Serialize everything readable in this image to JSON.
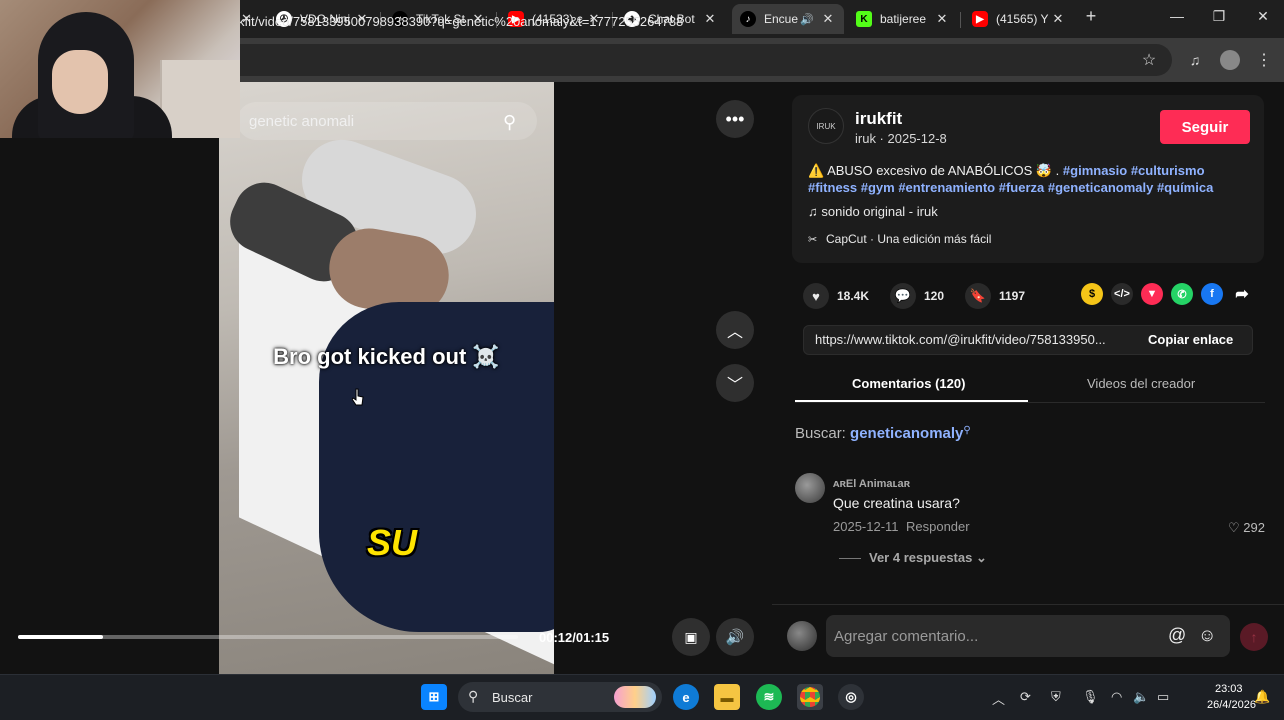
{
  "browser": {
    "tabs": [
      {
        "title": "VDO.Ninj",
        "icon": "vdo-ninja-icon",
        "icon_glyph": "✇",
        "color": "#ffffff"
      },
      {
        "title": "TikTok St",
        "icon": "tiktok-icon",
        "icon_glyph": "♪",
        "color": "#000000"
      },
      {
        "title": "(41533) c",
        "icon": "youtube-icon",
        "icon_glyph": "▶",
        "color": "#ff0000"
      },
      {
        "title": "Chat Bot",
        "icon": "chatbot-icon",
        "icon_glyph": "◆",
        "color": "#ffffff"
      },
      {
        "title": "Encue",
        "icon": "tiktok-icon",
        "icon_glyph": "♪",
        "color": "#000000",
        "active": true
      },
      {
        "title": "batijeree",
        "icon": "kick-icon",
        "icon_glyph": "K",
        "color": "#53fc18"
      },
      {
        "title": "(41565) Y",
        "icon": "youtube-icon",
        "icon_glyph": "▶",
        "color": "#ff0000"
      }
    ],
    "url": "kfit/video/7581339500798938390?q=genetic%20anomaly&t=1777255264788"
  },
  "video": {
    "search_query": "genetic anomali",
    "caption": "Bro got kicked out ☠️",
    "sticker_text": "SU",
    "time": "00:12/01:15",
    "progress": 0.17
  },
  "post": {
    "username": "irukfit",
    "subline": "iruk · 2025-12-8",
    "avatar_text": "IRUK",
    "follow_label": "Seguir",
    "description_prefix": "⚠️ ABUSO excesivo de ANABÓLICOS 🤯 . ",
    "hashtags": "#gimnasio #culturismo #fitness #gym #entrenamiento #fuerza #geneticanomaly #química",
    "music": "♫  sonido original - iruk",
    "capcut": "CapCut · Una edición más fácil",
    "likes": "18.4K",
    "comments": "120",
    "saves": "1197",
    "link": "https://www.tiktok.com/@irukfit/video/758133950...",
    "copy_label": "Copiar enlace",
    "tab_comments": "Comentarios (120)",
    "tab_creator": "Videos del creador",
    "search_label": "Buscar:",
    "search_keyword": "geneticanomaly"
  },
  "comment": {
    "user": "ᴀʀEl Animaʟaʀ",
    "text": "Que creatina usara?",
    "date": "2025-12-11",
    "reply_label": "Responder",
    "likes": "292",
    "more_label": "Ver 4 respuestas"
  },
  "compose": {
    "placeholder": "Agregar comentario..."
  },
  "taskbar": {
    "search_label": "Buscar",
    "time": "23:03",
    "date": "26/4/2026"
  },
  "colors": {
    "accent": "#fe2c55",
    "hashtag": "#8fb2ff"
  }
}
